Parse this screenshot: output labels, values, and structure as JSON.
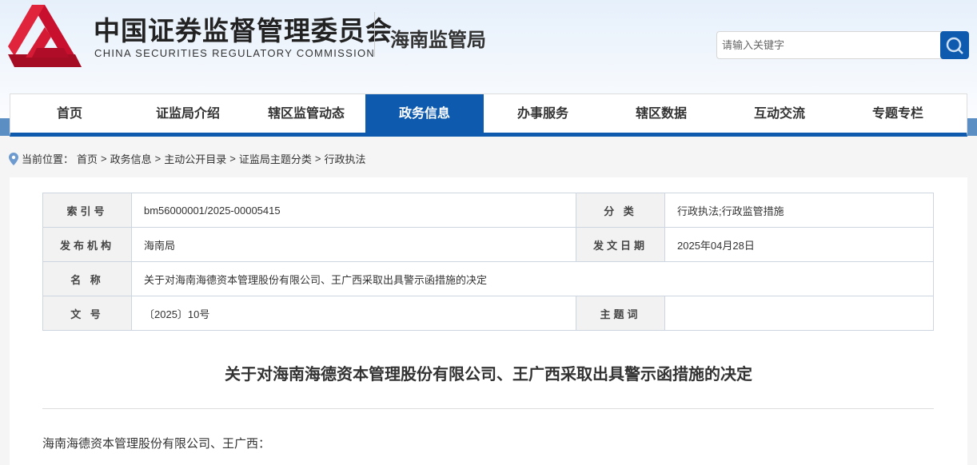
{
  "header": {
    "org_cn": "中国证券监督管理委员会",
    "org_en": "CHINA SECURITIES REGULATORY COMMISSION",
    "bureau": "海南监管局",
    "search_placeholder": "请输入关键字"
  },
  "nav": [
    "首页",
    "证监局介绍",
    "辖区监管动态",
    "政务信息",
    "办事服务",
    "辖区数据",
    "互动交流",
    "专题专栏"
  ],
  "breadcrumb": {
    "label": "当前位置：",
    "items": [
      "首页",
      "政务信息",
      "主动公开目录",
      "证监局主题分类",
      "行政执法"
    ],
    "sep": ">"
  },
  "meta": {
    "index_label": "索引号",
    "index": "bm56000001/2025-00005415",
    "category_label": "分 类",
    "category": "行政执法;行政监管措施",
    "publisher_label": "发布机构",
    "publisher": "海南局",
    "date_label": "发文日期",
    "date": "2025年04月28日",
    "name_label": "名 称",
    "name": "关于对海南海德资本管理股份有限公司、王广西采取出具警示函措施的决定",
    "docno_label": "文 号",
    "docno": "〔2025〕10号",
    "keywords_label": "主题词",
    "keywords": ""
  },
  "article": {
    "title": "关于对海南海德资本管理股份有限公司、王广西采取出具警示函措施的决定",
    "salutation": "海南海德资本管理股份有限公司、王广西："
  },
  "colors": {
    "brand": "#0d5aaf",
    "logo": "#c8102e"
  }
}
